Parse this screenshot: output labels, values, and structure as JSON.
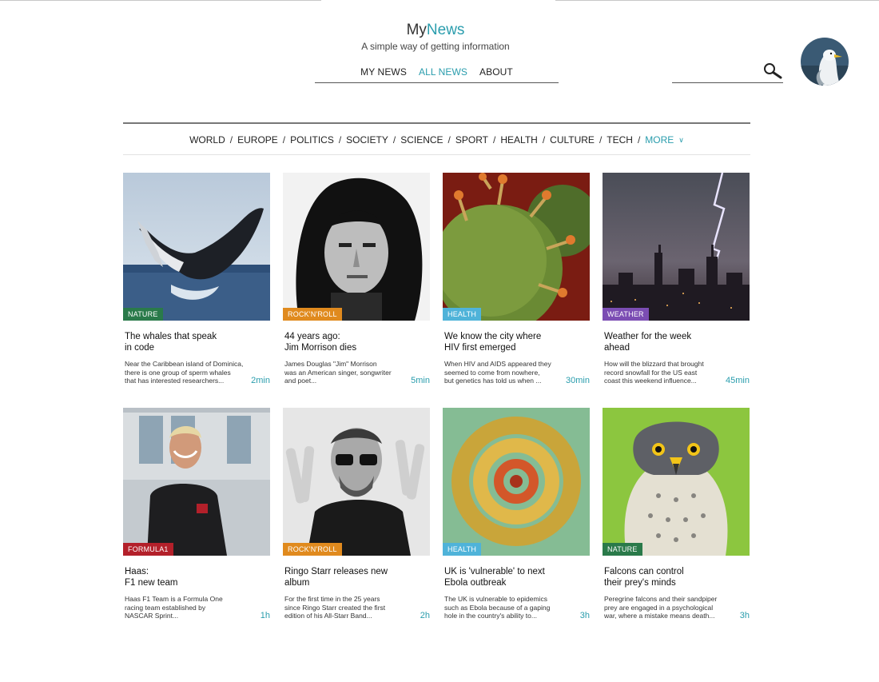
{
  "brand": {
    "name_part1": "My",
    "name_part2": "News",
    "tagline": "A simple way of getting information"
  },
  "nav": [
    {
      "label": "MY NEWS",
      "active": false
    },
    {
      "label": "ALL NEWS",
      "active": true
    },
    {
      "label": "ABOUT",
      "active": false
    }
  ],
  "search": {
    "placeholder": "",
    "value": "",
    "icon": "search-icon"
  },
  "user": {
    "avatar": "seagull-avatar"
  },
  "categories": [
    "WORLD",
    "EUROPE",
    "POLITICS",
    "SOCIETY",
    "SCIENCE",
    "SPORT",
    "HEALTH",
    "CULTURE",
    "TECH"
  ],
  "more": {
    "label": "MORE",
    "icon": "chevron-down-icon"
  },
  "colors": {
    "accent": "#2a9dad",
    "nature": "#2a7a4a",
    "rocknroll": "#e08a1e",
    "health": "#4fb3d9",
    "weather": "#7b4db3",
    "formula1": "#b3202a"
  },
  "articles": [
    {
      "tag": "NATURE",
      "tag_color": "#2a7a4a",
      "title1": "The whales that speak",
      "title2": "in code",
      "ex1": "Near the Caribbean island of Dominica,",
      "ex2": "there is one group of sperm whales",
      "ex3": "that has interested researchers...",
      "time": "2min",
      "image": "whale"
    },
    {
      "tag": "ROCK'N'ROLL",
      "tag_color": "#e08a1e",
      "title1": "44 years ago:",
      "title2": "Jim Morrison dies",
      "ex1": "James Douglas \"Jim\" Morrison",
      "ex2": "was an American singer, songwriter",
      "ex3": "and poet...",
      "time": "5min",
      "image": "portrait-bw"
    },
    {
      "tag": "HEALTH",
      "tag_color": "#4fb3d9",
      "title1": "We know the city where",
      "title2": "HIV first emerged",
      "ex1": "When HIV and AIDS appeared they",
      "ex2": "seemed to come from nowhere,",
      "ex3": "but genetics has told us when ...",
      "time": "30min",
      "image": "virus"
    },
    {
      "tag": "WEATHER",
      "tag_color": "#7b4db3",
      "title1": "Weather for the week",
      "title2": "ahead",
      "ex1": "How will the blizzard that brought",
      "ex2": "record snowfall for the US east",
      "ex3": "coast this weekend influence...",
      "time": "45min",
      "image": "lightning-city"
    },
    {
      "tag": "FORMULA1",
      "tag_color": "#b3202a",
      "title1": "Haas:",
      "title2": "F1 new team",
      "ex1": "Haas F1 Team is a Formula One",
      "ex2": "racing team established by",
      "ex3": "NASCAR Sprint...",
      "time": "1h",
      "image": "man-building"
    },
    {
      "tag": "ROCK'N'ROLL",
      "tag_color": "#e08a1e",
      "title1": "Ringo Starr releases new",
      "title2": "album",
      "ex1": "For the first time in the 25 years",
      "ex2": "since Ringo Starr created the first",
      "ex3": "edition of his All-Starr Band...",
      "time": "2h",
      "image": "peace-sign"
    },
    {
      "tag": "HEALTH",
      "tag_color": "#4fb3d9",
      "title1": "UK is 'vulnerable' to next",
      "title2": "Ebola outbreak",
      "ex1": "The UK is vulnerable to epidemics",
      "ex2": "such as Ebola because of a gaping",
      "ex3": "hole in the country's ability to...",
      "time": "3h",
      "image": "ebola"
    },
    {
      "tag": "NATURE",
      "tag_color": "#2a7a4a",
      "title1": "Falcons can control",
      "title2": "their prey's minds",
      "ex1": "Peregrine falcons and their sandpiper",
      "ex2": "prey are engaged in a psychological",
      "ex3": "war, where a mistake means death...",
      "time": "3h",
      "image": "falcon"
    }
  ]
}
